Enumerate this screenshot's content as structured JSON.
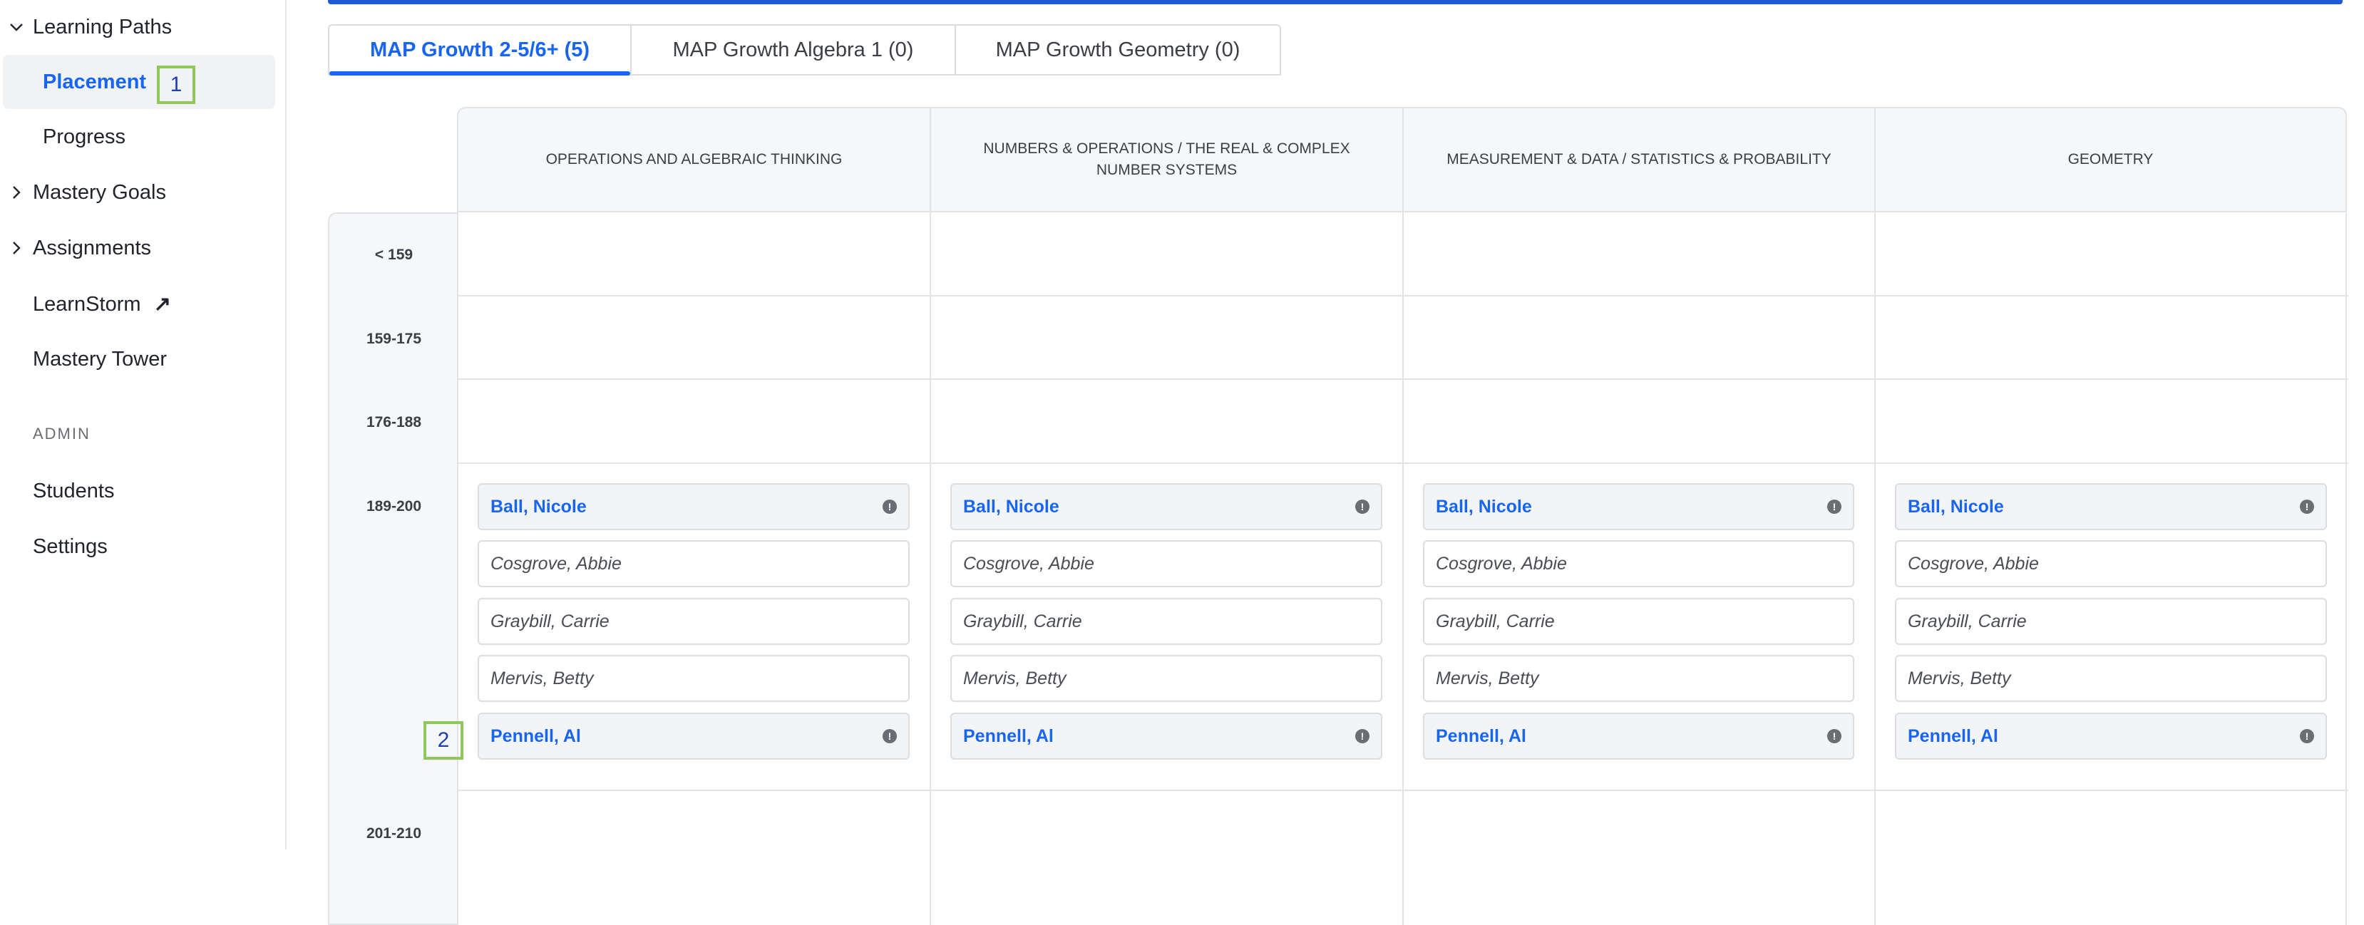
{
  "sidebar": {
    "learning_paths": "Learning Paths",
    "placement": "Placement",
    "progress": "Progress",
    "mastery_goals": "Mastery Goals",
    "assignments": "Assignments",
    "learnstorm": "LearnStorm",
    "mastery_tower": "Mastery Tower",
    "admin_heading": "ADMIN",
    "students": "Students",
    "settings": "Settings"
  },
  "markers": {
    "m1": "1",
    "m2": "2"
  },
  "tabs": [
    {
      "label": "MAP Growth 2-5/6+ (5)",
      "active": true
    },
    {
      "label": "MAP Growth Algebra 1 (0)",
      "active": false
    },
    {
      "label": "MAP Growth Geometry (0)",
      "active": false
    }
  ],
  "columns": [
    "OPERATIONS AND ALGEBRAIC THINKING",
    "NUMBERS & OPERATIONS / THE REAL & COMPLEX NUMBER SYSTEMS",
    "MEASUREMENT & DATA / STATISTICS & PROBABILITY",
    "GEOMETRY"
  ],
  "rows": [
    "< 159",
    "159-175",
    "176-188",
    "189-200",
    "201-210"
  ],
  "students": [
    {
      "name": "Ball, Nicole",
      "flagged": true
    },
    {
      "name": "Cosgrove, Abbie",
      "flagged": false
    },
    {
      "name": "Graybill, Carrie",
      "flagged": false
    },
    {
      "name": "Mervis, Betty",
      "flagged": false
    },
    {
      "name": "Pennell, Al",
      "flagged": true
    }
  ],
  "info_glyph": "!",
  "arrow_glyph": "↗",
  "colors": {
    "accent": "#1865f2",
    "marker": "#8fc85a",
    "top_bar": "#1f5ad6"
  }
}
